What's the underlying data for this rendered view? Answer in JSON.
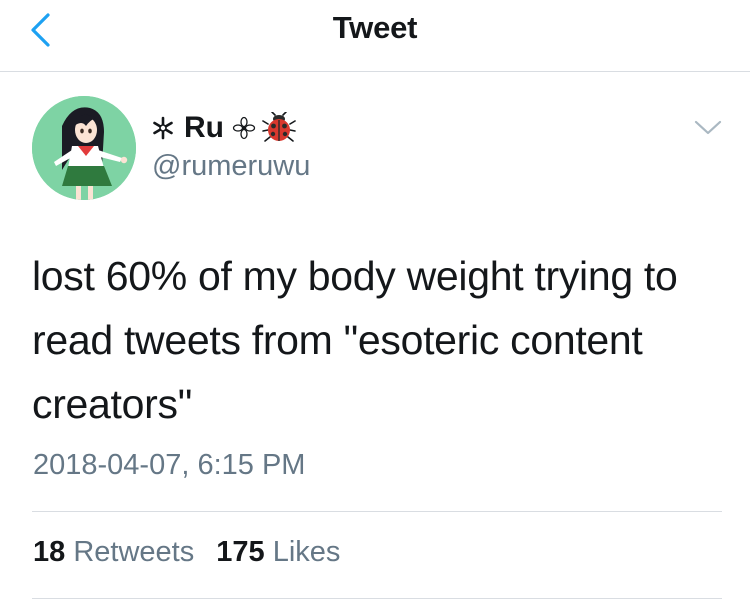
{
  "header": {
    "title": "Tweet",
    "back_icon": "chevron-left-icon"
  },
  "author": {
    "display_name": "Ru",
    "name_prefix_icon": "flower-asterisk-icon",
    "name_suffix_icons": [
      "sakura-outline-icon",
      "ladybug-icon"
    ],
    "handle": "@rumeruwu",
    "avatar": "anime-girl-avatar"
  },
  "tweet": {
    "text": "lost 60% of my body weight trying to read tweets from \"esoteric content creators\"",
    "timestamp": "2018-04-07, 6:15 PM"
  },
  "stats": {
    "retweets_count": "18",
    "retweets_label": "Retweets",
    "likes_count": "175",
    "likes_label": "Likes"
  },
  "colors": {
    "accent": "#1da1f2",
    "text": "#14171a",
    "secondary_text": "#657786",
    "divider": "#d9dde2"
  }
}
